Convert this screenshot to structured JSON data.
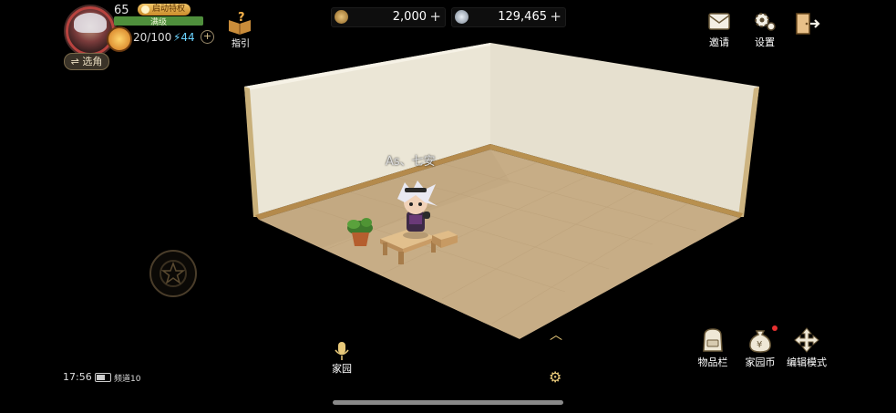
{
  "player": {
    "level": "65",
    "vip_label": "启动特权",
    "exp_label": "满级",
    "exp_fraction": 1.0,
    "stamina": "20/100",
    "energy": "⚡44",
    "switch_role_label": "⇌ 选角",
    "name": "As、七安"
  },
  "guide": {
    "label": "指引"
  },
  "currency": {
    "gold": "2,000",
    "silver": "129,465",
    "plus": "+"
  },
  "top_right": {
    "invite_label": "邀请",
    "settings_label": "设置"
  },
  "bottom": {
    "time": "17:56",
    "channel": "频道10",
    "home_label": "家园",
    "inventory_label": "物品栏",
    "home_coin_label": "家园币",
    "edit_mode_label": "编辑模式"
  },
  "colors": {
    "wall": "#e9e3d2",
    "floor": "#c9b08a",
    "accent": "#e8c97a"
  }
}
